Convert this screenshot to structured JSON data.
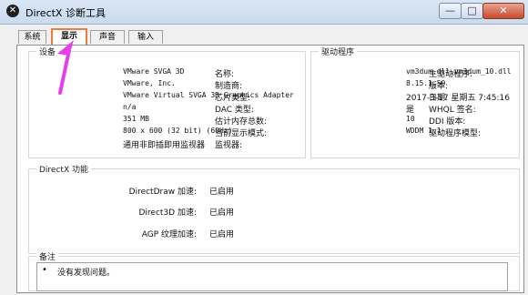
{
  "window": {
    "title": "DirectX 诊断工具",
    "icon": "directx-icon",
    "buttons": [
      "—",
      "□",
      "✕"
    ]
  },
  "tabs": [
    {
      "label": "系统"
    },
    {
      "label": "显示"
    },
    {
      "label": "声音"
    },
    {
      "label": "输入"
    }
  ],
  "device": {
    "title": "设备",
    "rows": [
      {
        "label": "名称:",
        "value": "VMware SVGA 3D"
      },
      {
        "label": "制造商:",
        "value": "VMware, Inc."
      },
      {
        "label": "芯片类型:",
        "value": "VMware Virtual SVGA 3D Graphics Adapter"
      },
      {
        "label": "DAC 类型:",
        "value": "n/a"
      },
      {
        "label": "估计内存总数:",
        "value": "351 MB"
      },
      {
        "label": "当前显示模式:",
        "value": "800 x 600 (32 bit) (60Hz)"
      },
      {
        "label": "监视器:",
        "value": "通用非即插即用监视器"
      }
    ]
  },
  "driver": {
    "title": "驱动程序",
    "rows": [
      {
        "label": "主驱动程序:",
        "value": "vm3dum.dll,vm3dum_10.dll"
      },
      {
        "label": "版本:",
        "value": "8.15.1.50"
      },
      {
        "label": "日期:",
        "value": "2017-3-17 星期五 7:45:16"
      },
      {
        "label": "WHQL 签名:",
        "value": "是"
      },
      {
        "label": "DDI 版本:",
        "value": "10"
      },
      {
        "label": "驱动程序模型:",
        "value": "WDDM 1.1"
      }
    ]
  },
  "directx": {
    "title": "DirectX 功能",
    "rows": [
      {
        "label": "DirectDraw 加速:",
        "value": "已启用"
      },
      {
        "label": "Direct3D 加速:",
        "value": "已启用"
      },
      {
        "label": "AGP 纹理加速:",
        "value": "已启用"
      }
    ]
  },
  "notes": {
    "title": "备注",
    "text": "没有发现问题。"
  },
  "colors": {
    "highlight": "#f27a3f",
    "arrow": "#e83ee8"
  }
}
